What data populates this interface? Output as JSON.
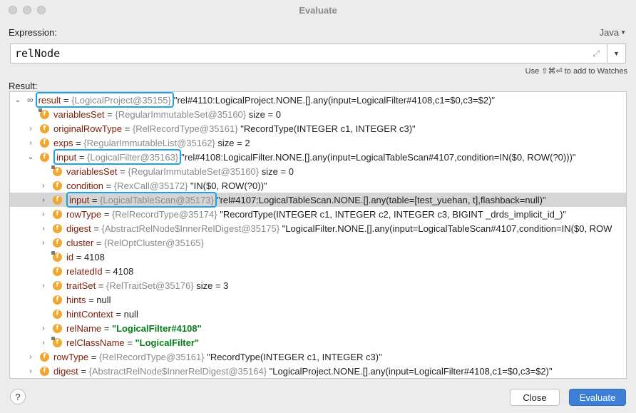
{
  "window": {
    "title": "Evaluate"
  },
  "expression": {
    "label": "Expression:",
    "value": "relNode",
    "language": "Java",
    "hint": "Use ⇧⌘⏎ to add to Watches"
  },
  "result": {
    "label": "Result:",
    "rows": [
      {
        "indent": 0,
        "expanded": true,
        "icon": "oo",
        "name": "result",
        "ref": "{LogicalProject@35155}",
        "value": "\"rel#4110:LogicalProject.NONE.[].any(input=LogicalFilter#4108,c1=$0,c3=$2)\"",
        "highlight": true
      },
      {
        "indent": 1,
        "expanded": null,
        "icon": "f-lock",
        "name": "variablesSet",
        "ref": "{RegularImmutableSet@35160}",
        "value": "size = 0"
      },
      {
        "indent": 1,
        "expanded": false,
        "icon": "f",
        "name": "originalRowType",
        "ref": "{RelRecordType@35161}",
        "value": "\"RecordType(INTEGER c1, INTEGER c3)\""
      },
      {
        "indent": 1,
        "expanded": false,
        "icon": "f",
        "name": "exps",
        "ref": "{RegularImmutableList@35162}",
        "value": "size = 2"
      },
      {
        "indent": 1,
        "expanded": true,
        "icon": "f",
        "name": "input",
        "ref": "{LogicalFilter@35163}",
        "value": "\"rel#4108:LogicalFilter.NONE.[].any(input=LogicalTableScan#4107,condition=IN($0, ROW(?0)))\"",
        "highlight": true
      },
      {
        "indent": 2,
        "expanded": null,
        "icon": "f-lock",
        "name": "variablesSet",
        "ref": "{RegularImmutableSet@35160}",
        "value": "size = 0"
      },
      {
        "indent": 2,
        "expanded": false,
        "icon": "f",
        "name": "condition",
        "ref": "{RexCall@35172}",
        "value": "\"IN($0, ROW(?0))\""
      },
      {
        "indent": 2,
        "expanded": false,
        "icon": "f",
        "name": "input",
        "ref": "{LogicalTableScan@35173}",
        "value": "\"rel#4107:LogicalTableScan.NONE.[].any(table=[test_yuehan, t],flashback=null)\"",
        "highlight": true,
        "selected": true
      },
      {
        "indent": 2,
        "expanded": false,
        "icon": "f",
        "name": "rowType",
        "ref": "{RelRecordType@35174}",
        "value": "\"RecordType(INTEGER c1, INTEGER c2, INTEGER c3, BIGINT _drds_implicit_id_)\""
      },
      {
        "indent": 2,
        "expanded": false,
        "icon": "f",
        "name": "digest",
        "ref": "{AbstractRelNode$InnerRelDigest@35175}",
        "value": "\"LogicalFilter.NONE.[].any(input=LogicalTableScan#4107,condition=IN($0, ROW"
      },
      {
        "indent": 2,
        "expanded": false,
        "icon": "f",
        "name": "cluster",
        "ref": "{RelOptCluster@35165}",
        "value": ""
      },
      {
        "indent": 2,
        "expanded": null,
        "icon": "f-lock",
        "name": "id",
        "ref": "",
        "value": "4108"
      },
      {
        "indent": 2,
        "expanded": null,
        "icon": "f",
        "name": "relatedId",
        "ref": "",
        "value": "4108"
      },
      {
        "indent": 2,
        "expanded": false,
        "icon": "f",
        "name": "traitSet",
        "ref": "{RelTraitSet@35176}",
        "value": "size = 3"
      },
      {
        "indent": 2,
        "expanded": null,
        "icon": "f",
        "name": "hints",
        "ref": "",
        "value": "null"
      },
      {
        "indent": 2,
        "expanded": null,
        "icon": "f",
        "name": "hintContext",
        "ref": "",
        "value": "null"
      },
      {
        "indent": 2,
        "expanded": false,
        "icon": "f",
        "name": "relName",
        "ref": "",
        "value": "\"LogicalFilter#4108\"",
        "string": true
      },
      {
        "indent": 2,
        "expanded": false,
        "icon": "f-lock",
        "name": "relClassName",
        "ref": "",
        "value": "\"LogicalFilter\"",
        "string": true
      },
      {
        "indent": 1,
        "expanded": false,
        "icon": "f",
        "name": "rowType",
        "ref": "{RelRecordType@35161}",
        "value": "\"RecordType(INTEGER c1, INTEGER c3)\""
      },
      {
        "indent": 1,
        "expanded": false,
        "icon": "f",
        "name": "digest",
        "ref": "{AbstractRelNode$InnerRelDigest@35164}",
        "value": "\"LogicalProject.NONE.[].any(input=LogicalFilter#4108,c1=$0,c3=$2)\""
      }
    ]
  },
  "buttons": {
    "help": "?",
    "close": "Close",
    "evaluate": "Evaluate"
  }
}
